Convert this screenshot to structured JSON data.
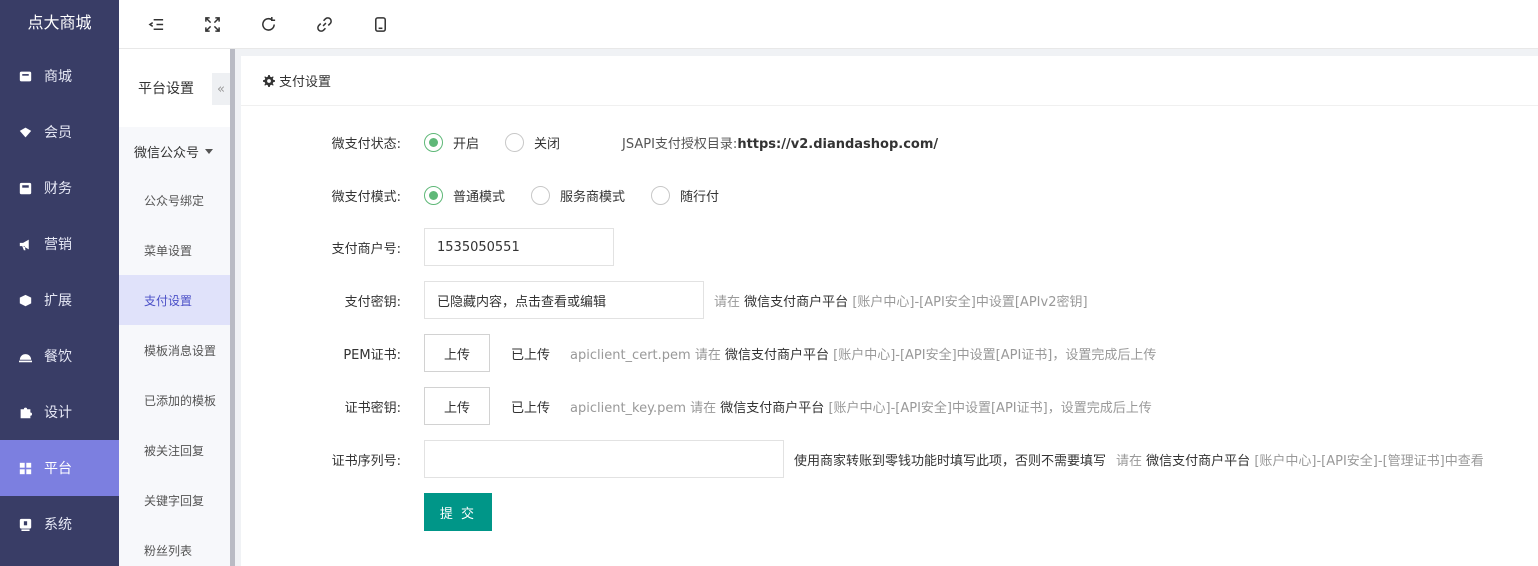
{
  "brand": "点大商城",
  "sidebar": {
    "items": [
      {
        "label": "商城",
        "icon": "shop-icon"
      },
      {
        "label": "会员",
        "icon": "member-icon"
      },
      {
        "label": "财务",
        "icon": "finance-icon"
      },
      {
        "label": "营销",
        "icon": "megaphone-icon"
      },
      {
        "label": "扩展",
        "icon": "cube-icon"
      },
      {
        "label": "餐饮",
        "icon": "dish-icon"
      },
      {
        "label": "设计",
        "icon": "puzzle-icon"
      },
      {
        "label": "平台",
        "icon": "grid-icon"
      },
      {
        "label": "系统",
        "icon": "system-icon"
      }
    ],
    "active_index": 7
  },
  "toolbar": {
    "icons": [
      "menu-fold-icon",
      "fullscreen-icon",
      "refresh-icon",
      "link-icon",
      "tablet-icon"
    ]
  },
  "subnav": {
    "title": "平台设置",
    "collapse": "«",
    "group": "微信公众号",
    "items": [
      "公众号绑定",
      "菜单设置",
      "支付设置",
      "模板消息设置",
      "已添加的模板",
      "被关注回复",
      "关键字回复",
      "粉丝列表"
    ],
    "active_index": 2
  },
  "panel": {
    "title": "支付设置"
  },
  "form": {
    "status": {
      "label": "微支付状态:",
      "options": [
        "开启",
        "关闭"
      ],
      "selected": 0,
      "extra_label": "JSAPI支付授权目录:",
      "extra_value": "https://v2.diandashop.com/"
    },
    "mode": {
      "label": "微支付模式:",
      "options": [
        "普通模式",
        "服务商模式",
        "随行付"
      ],
      "selected": 0
    },
    "merchant": {
      "label": "支付商户号:",
      "value": "1535050551"
    },
    "secret": {
      "label": "支付密钥:",
      "value": "已隐藏内容，点击查看或编辑",
      "hint_pre": "请在",
      "hint_platform": "微信支付商户平台",
      "hint_post": "[账户中心]-[API安全]中设置[APIv2密钥]"
    },
    "pem": {
      "label": "PEM证书:",
      "button": "上传",
      "uploaded": "已上传",
      "hint_pre": "apiclient_cert.pem 请在",
      "hint_platform": "微信支付商户平台",
      "hint_post": "[账户中心]-[API安全]中设置[API证书]，设置完成后上传"
    },
    "certkey": {
      "label": "证书密钥:",
      "button": "上传",
      "uploaded": "已上传",
      "hint_pre": "apiclient_key.pem 请在",
      "hint_platform": "微信支付商户平台",
      "hint_post": "[账户中心]-[API安全]中设置[API证书]，设置完成后上传"
    },
    "serial": {
      "label": "证书序列号:",
      "value": "",
      "note": "使用商家转账到零钱功能时填写此项，否则不需要填写",
      "hint_pre": "请在",
      "hint_platform": "微信支付商户平台",
      "hint_post": "[账户中心]-[API安全]-[管理证书]中查看"
    },
    "submit": "提 交"
  }
}
